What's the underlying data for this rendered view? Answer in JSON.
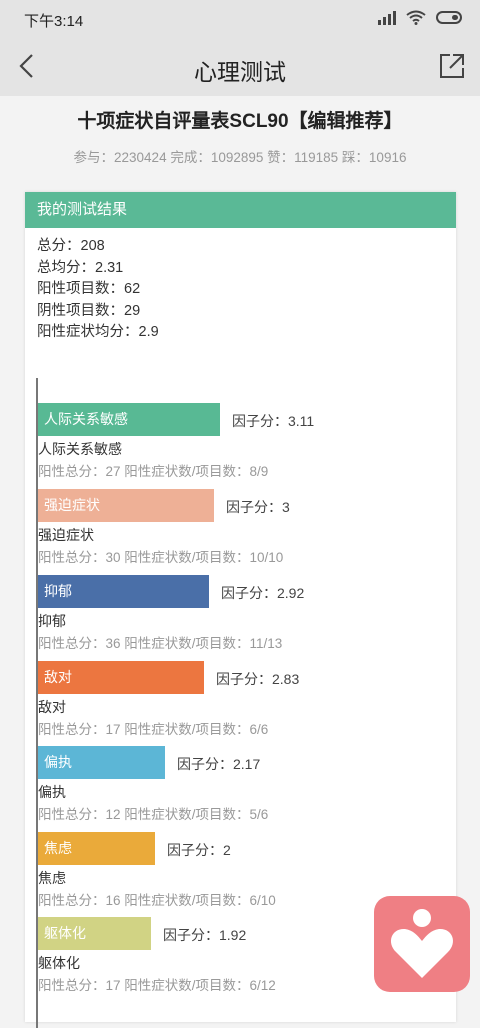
{
  "status": {
    "time": "下午3:14"
  },
  "nav": {
    "title": "心理测试"
  },
  "test": {
    "title": "十项症状自评量表SCL90【编辑推荐】",
    "stats": "参与：2230424 完成：1092895 赞：119185 踩：10916"
  },
  "result": {
    "header": "我的测试结果",
    "summary": [
      "总分：208",
      "总均分：2.31",
      "阳性项目数：62",
      "阴性项目数：29",
      "阳性症状均分：2.9"
    ]
  },
  "factors": [
    {
      "name": "人际关系敏感",
      "score_label": "因子分：3.11",
      "score": 3.11,
      "color": "#58b994",
      "detail": "阳性总分：27   阳性症状数/项目数：8/9"
    },
    {
      "name": "强迫症状",
      "score_label": "因子分：3",
      "score": 3,
      "color": "#eeb096",
      "detail": "阳性总分：30   阳性症状数/项目数：10/10"
    },
    {
      "name": "抑郁",
      "score_label": "因子分：2.92",
      "score": 2.92,
      "color": "#4a6fa8",
      "detail": "阳性总分：36   阳性症状数/项目数：11/13"
    },
    {
      "name": "敌对",
      "score_label": "因子分：2.83",
      "score": 2.83,
      "color": "#ec7640",
      "detail": "阳性总分：17   阳性症状数/项目数：6/6"
    },
    {
      "name": "偏执",
      "score_label": "因子分：2.17",
      "score": 2.17,
      "color": "#5cb6d6",
      "detail": "阳性总分：12   阳性症状数/项目数：5/6"
    },
    {
      "name": "焦虑",
      "score_label": "因子分：2",
      "score": 2,
      "color": "#eaaa3a",
      "detail": "阳性总分：16   阳性症状数/项目数：6/10"
    },
    {
      "name": "躯体化",
      "score_label": "因子分：1.92",
      "score": 1.92,
      "color": "#d1d384",
      "detail": "阳性总分：17   阳性症状数/项目数：6/12"
    }
  ]
}
